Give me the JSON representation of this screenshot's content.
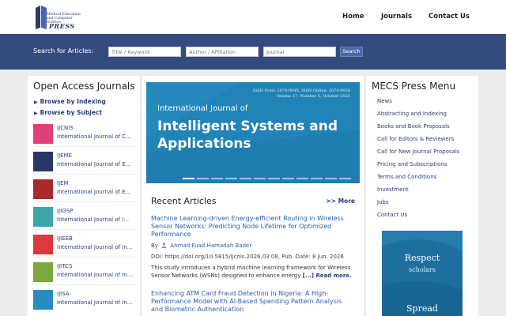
{
  "header": {
    "logo_text": "Medical Education and Computer Science",
    "logo_press": "PRESS",
    "nav": [
      {
        "label": "Home"
      },
      {
        "label": "Journals"
      },
      {
        "label": "Contact Us"
      }
    ]
  },
  "search": {
    "label": "Search for Articles:",
    "title_placeholder": "Title / Keyword",
    "author_placeholder": "Author / Affiliation",
    "journal_placeholder": "Journal",
    "button_label": "Search"
  },
  "left": {
    "title": "Open Access Journals",
    "browse_indexing": "Browse by Indexing",
    "browse_subject": "Browse by Subject",
    "journals": [
      {
        "abbr": "IJCNIS",
        "name": "International Journal of C...",
        "color": "#e0407a"
      },
      {
        "abbr": "IJEME",
        "name": "International Journal of E...",
        "color": "#2c3568"
      },
      {
        "abbr": "IJEM",
        "name": "International Journal of E...",
        "color": "#a82a2a"
      },
      {
        "abbr": "IJIGSP",
        "name": "International Journal of I...",
        "color": "#3aa6a8"
      },
      {
        "abbr": "IJIEEB",
        "name": "International Journal of In...",
        "color": "#d93a3a"
      },
      {
        "abbr": "IJITCS",
        "name": "International Journal of In...",
        "color": "#7aa83a"
      },
      {
        "abbr": "IJISA",
        "name": "International Journal of In...",
        "color": "#2a8ac2"
      }
    ]
  },
  "banner": {
    "issn_line1": "ISSN Print: 2074-904X, ISSN Online: 2074-9058",
    "issn_line2": "Volume 17, Number 5, October 2025",
    "title_line1": "International Journal of",
    "title_line2": "Intelligent Systems and Applications",
    "color": "#2183b6"
  },
  "recent": {
    "title": "Recent Articles",
    "more": ">> More",
    "articles": [
      {
        "title": "Machine Learning-driven Energy-efficient Routing in Wireless Sensor Networks: Predicting Node Lifetime for Optimized Performance",
        "by": "By",
        "author": "Ahmad Fuad Hamadah Bader",
        "doi": "DOI: https://doi.org/10.5815/ijcnis.2026.03.08, Pub. Date: 8 Jun. 2026",
        "abstract": "This study introduces a hybrid machine learning framework for Wireless Sensor Networks (WSNs) designed to enhance energy",
        "read_more": "[...] Read more."
      },
      {
        "title": "Enhancing ATM Card Fraud Detection in Nigeria: A High-Performance Model with AI-Based Spending Pattern Analysis and Biometric Authentication"
      }
    ]
  },
  "right": {
    "title": "MECS Press Menu",
    "menu": [
      "News",
      "Abstracting and Indexing",
      "Books and Book Proposals",
      "Call for Editors & Reviewers",
      "Call for New Journal Proposals",
      "Pricing and Subscriptions",
      "Terms and Conditions",
      "Investment",
      "Jobs",
      "Contact Us"
    ],
    "ad_line1": "Respect",
    "ad_line2": "scholars",
    "ad_line3": "Spread"
  },
  "colors": {
    "search_bar": "#354a7f",
    "link": "#2b3f77",
    "article_title": "#2b5fa8"
  }
}
